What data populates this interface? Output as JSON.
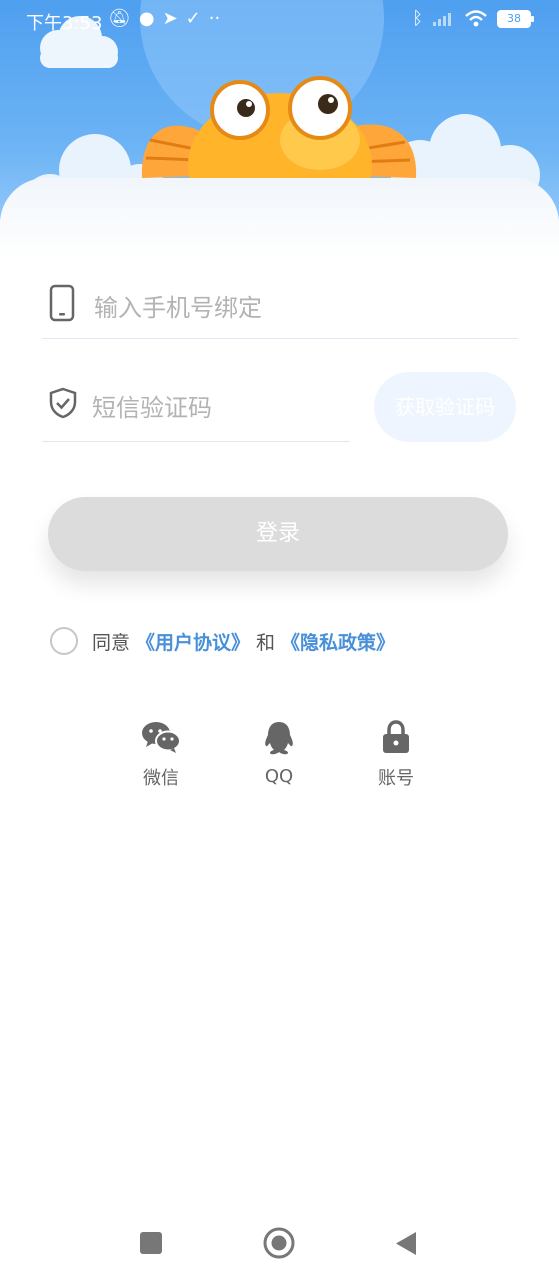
{
  "status_bar": {
    "time": "下午3:53",
    "battery": "38"
  },
  "form": {
    "phone_placeholder": "输入手机号绑定",
    "code_placeholder": "短信验证码",
    "get_code_label": "获取验证码",
    "login_label": "登录"
  },
  "agreement": {
    "prefix": "同意",
    "user_agreement": "《用户协议》",
    "and": "和",
    "privacy_policy": "《隐私政策》"
  },
  "social_login": [
    {
      "label": "微信",
      "icon": "wechat-icon"
    },
    {
      "label": "QQ",
      "icon": "qq-icon"
    },
    {
      "label": "账号",
      "icon": "lock-icon"
    }
  ],
  "colors": {
    "accent": "#4a90d9",
    "header_blue": "#5aa6f2",
    "fish_orange": "#ffae1f",
    "button_disabled": "#dcdcdc"
  }
}
